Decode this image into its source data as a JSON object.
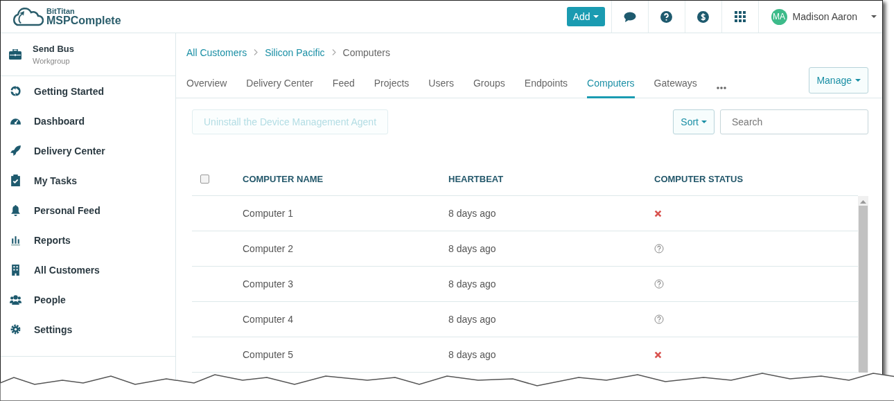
{
  "header": {
    "logo": {
      "brand": "BitTitan",
      "product": "MSPComplete"
    },
    "add_button": "Add",
    "user": {
      "initials": "MA",
      "name": "Madison Aaron"
    }
  },
  "sidebar": {
    "workspace": {
      "name": "Send Bus",
      "type": "Workgroup"
    },
    "items": [
      {
        "label": "Getting Started"
      },
      {
        "label": "Dashboard"
      },
      {
        "label": "Delivery Center"
      },
      {
        "label": "My Tasks"
      },
      {
        "label": "Personal Feed"
      },
      {
        "label": "Reports"
      },
      {
        "label": "All Customers"
      },
      {
        "label": "People"
      },
      {
        "label": "Settings"
      }
    ]
  },
  "breadcrumb": [
    {
      "label": "All Customers",
      "link": true
    },
    {
      "label": "Silicon Pacific",
      "link": true
    },
    {
      "label": "Computers",
      "link": false
    }
  ],
  "tabs": [
    {
      "label": "Overview",
      "selected": false
    },
    {
      "label": "Delivery Center",
      "selected": false
    },
    {
      "label": "Feed",
      "selected": false
    },
    {
      "label": "Projects",
      "selected": false
    },
    {
      "label": "Users",
      "selected": false
    },
    {
      "label": "Groups",
      "selected": false
    },
    {
      "label": "Endpoints",
      "selected": false
    },
    {
      "label": "Computers",
      "selected": true
    },
    {
      "label": "Gateways",
      "selected": false
    }
  ],
  "manage_button": "Manage",
  "toolbar": {
    "action_button": {
      "label": "Uninstall the Device Management Agent",
      "disabled": true
    },
    "sort_button": "Sort",
    "search": {
      "placeholder": "Search"
    }
  },
  "table": {
    "select_all": {
      "checked": false
    },
    "columns": [
      "COMPUTER NAME",
      "HEARTBEAT",
      "COMPUTER STATUS"
    ],
    "rows": [
      {
        "name": "Computer 1",
        "heartbeat": "8 days ago",
        "kind": "failed"
      },
      {
        "name": "Computer 2",
        "heartbeat": "8 days ago",
        "kind": "unknown"
      },
      {
        "name": "Computer 3",
        "heartbeat": "8 days ago",
        "kind": "unknown"
      },
      {
        "name": "Computer 4",
        "heartbeat": "8 days ago",
        "kind": "unknown"
      },
      {
        "name": "Computer 5",
        "heartbeat": "8 days ago",
        "kind": "failed"
      }
    ]
  }
}
